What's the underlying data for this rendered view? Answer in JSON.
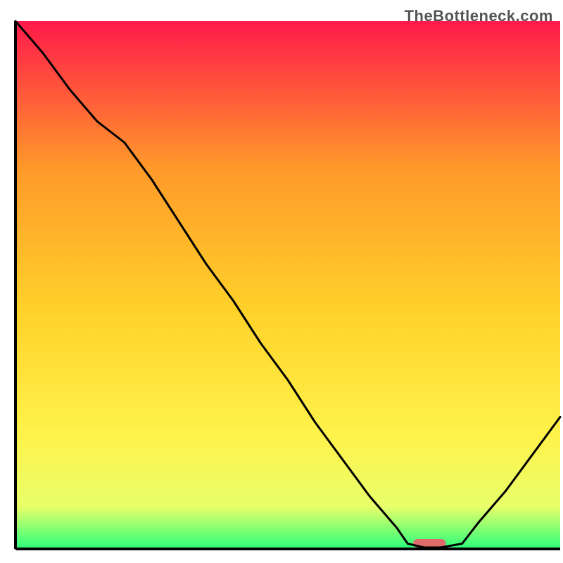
{
  "watermark": "TheBottleneck.com",
  "chart_data": {
    "type": "line",
    "title": "",
    "xlabel": "",
    "ylabel": "",
    "xlim": [
      0,
      100
    ],
    "ylim": [
      0,
      100
    ],
    "grid": false,
    "legend": false,
    "annotations": [],
    "background_gradient": [
      "#ff1a4a",
      "#ff9a2a",
      "#ffd22a",
      "#fff24a",
      "#e8ff6a",
      "#2aff7a"
    ],
    "series": [
      {
        "name": "bottleneck-curve",
        "x": [
          0,
          5,
          10,
          15,
          20,
          25,
          30,
          35,
          40,
          45,
          50,
          55,
          60,
          65,
          70,
          72,
          75,
          78,
          82,
          85,
          90,
          95,
          100
        ],
        "y": [
          100,
          94,
          87,
          81,
          77,
          70,
          62,
          54,
          47,
          39,
          32,
          24,
          17,
          10,
          4,
          1,
          0,
          0,
          1,
          5,
          11,
          18,
          25
        ]
      }
    ],
    "marker": {
      "x": 76,
      "y": 0,
      "width": 6,
      "color": "#e06b6b"
    },
    "axis_color": "#000000",
    "line_color": "#000000"
  }
}
